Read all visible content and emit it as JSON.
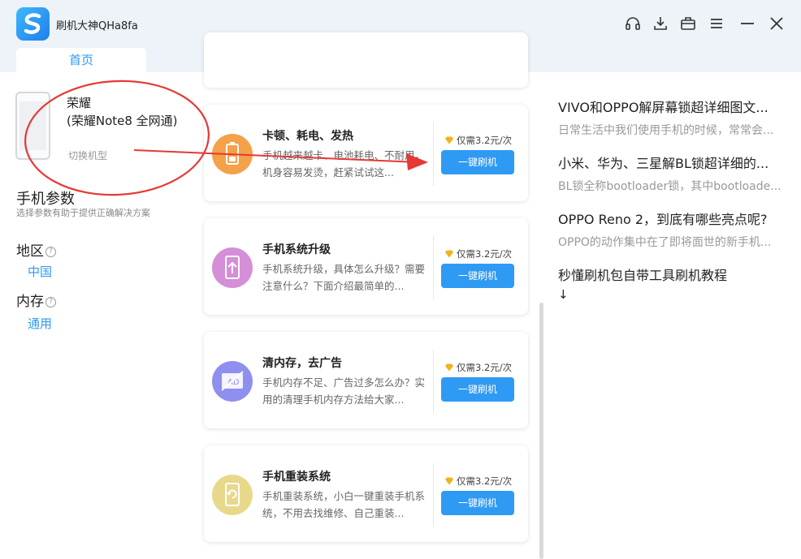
{
  "app": {
    "title": "刷机大神QHa8fa",
    "accent": "#2e9af3"
  },
  "tabs": [
    {
      "label": "首页"
    }
  ],
  "device": {
    "brand": "荣耀",
    "model": "(荣耀Note8 全网通)",
    "switch_label": "切换机型"
  },
  "params": {
    "title": "手机参数",
    "subtitle": "选择参数有助于提供正确解决方案",
    "region": {
      "label": "地区",
      "value": "中国"
    },
    "memory": {
      "label": "内存",
      "value": "通用"
    }
  },
  "cards": [
    {
      "title": "卡顿、耗电、发热",
      "desc": "手机越来越卡、电池耗电、不耐用，机身容易发烫，赶紧试试这...",
      "price": "仅需3.2元/次",
      "button": "一键刷机",
      "icon": "battery-icon",
      "color": "#f5a14a"
    },
    {
      "title": "手机系统升级",
      "desc": "手机系统升级，具体怎么升级？需要注意什么？下面介绍最简单的...",
      "price": "仅需3.2元/次",
      "button": "一键刷机",
      "icon": "upgrade-icon",
      "color": "#d58ed8"
    },
    {
      "title": "清内存，去广告",
      "desc": "手机内存不足、广告过多怎么办？实用的清理手机内存方法给大家...",
      "price": "仅需3.2元/次",
      "button": "一键刷机",
      "icon": "ad-block-icon",
      "color": "#8f8ff0"
    },
    {
      "title": "手机重装系统",
      "desc": "手机重装系统，小白一键重装手机系统，不用去找维修、自己重装...",
      "price": "仅需3.2元/次",
      "button": "一键刷机",
      "icon": "reinstall-icon",
      "color": "#e8d98a"
    }
  ],
  "articles": [
    {
      "title": "VIVO和OPPO解屏幕锁超详细图文...",
      "desc": "日常生活中我们使用手机的时候，常常会..."
    },
    {
      "title": "小米、华为、三星解BL锁超详细的...",
      "desc": "BL锁全称bootloader锁，其中bootloade..."
    },
    {
      "title": "OPPO Reno 2，到底有哪些亮点呢?",
      "desc": "OPPO的动作集中在了即将面世的新手机..."
    },
    {
      "title": "秒懂刷机包自带工具刷机教程",
      "desc": "↓"
    }
  ]
}
